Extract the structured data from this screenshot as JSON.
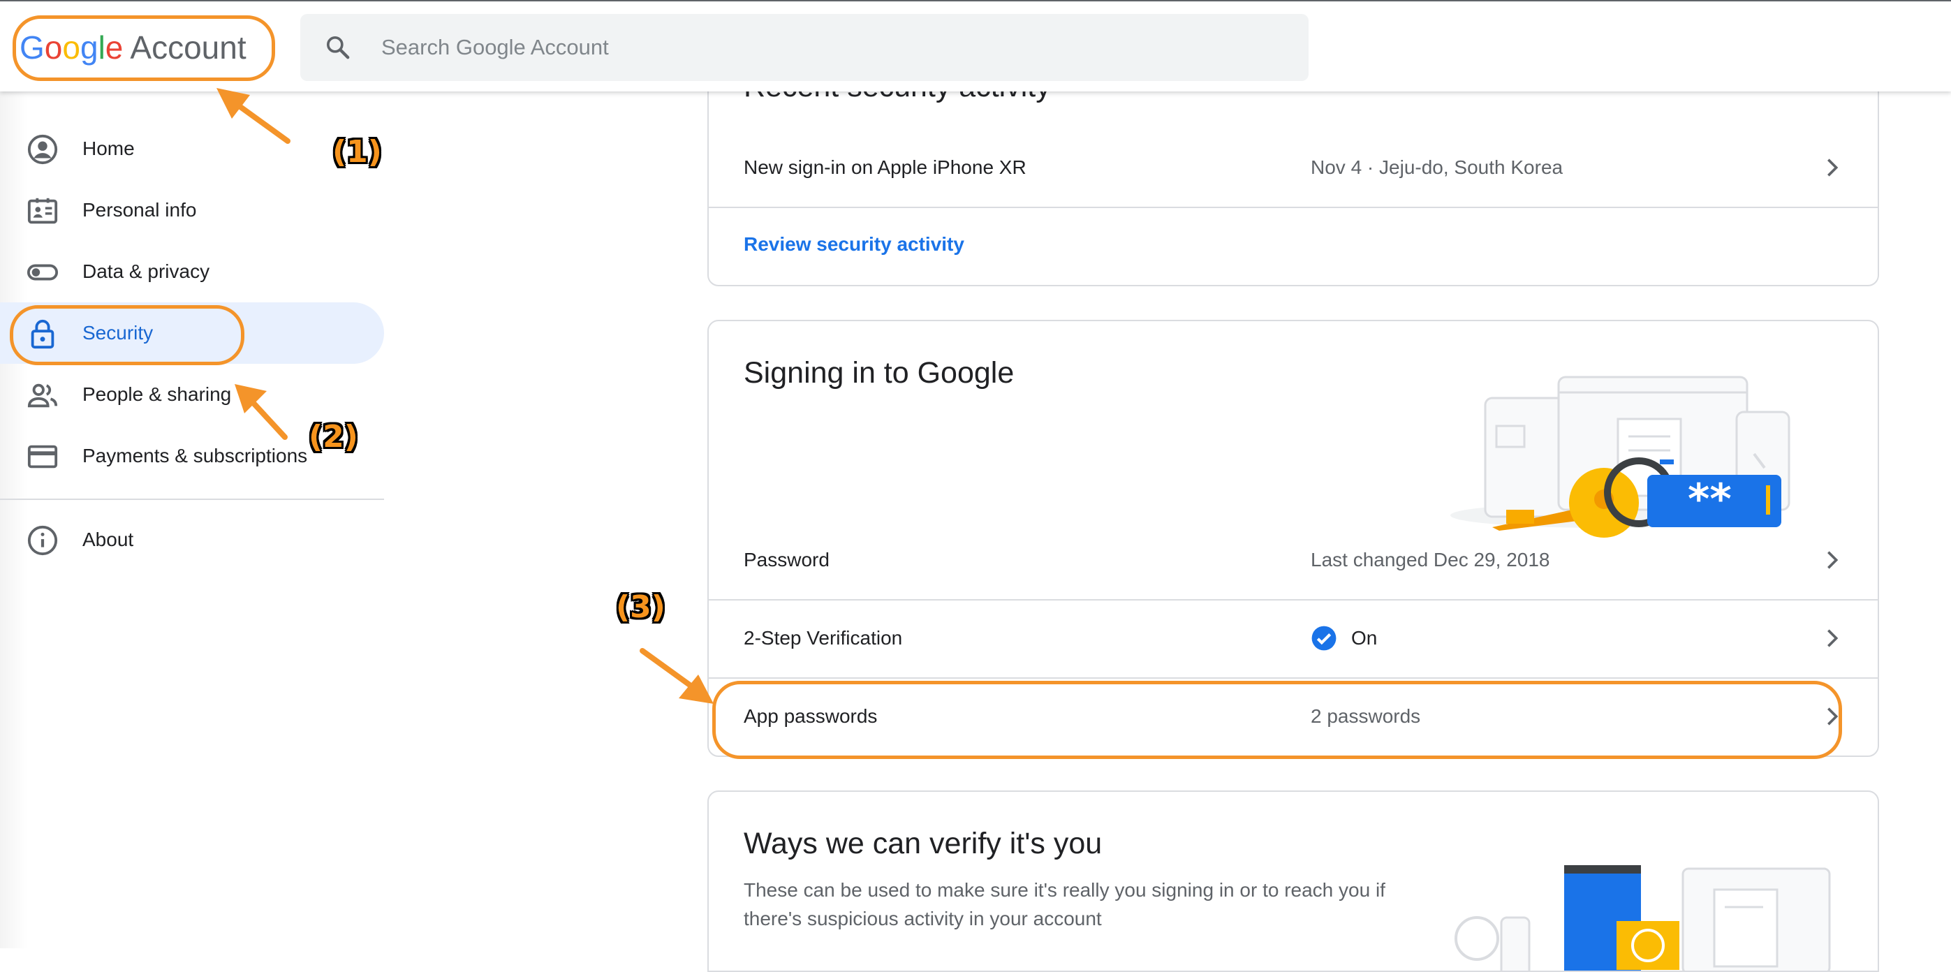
{
  "header": {
    "logo_letters": [
      "G",
      "o",
      "o",
      "g",
      "l",
      "e"
    ],
    "logo_colors": [
      "#4285f4",
      "#ea4335",
      "#fbbc05",
      "#4285f4",
      "#34a853",
      "#ea4335"
    ],
    "logo_account": "Account",
    "search_placeholder": "Search Google Account"
  },
  "sidebar": {
    "items": [
      {
        "label": "Home",
        "icon": "account-circle-icon"
      },
      {
        "label": "Personal info",
        "icon": "id-card-icon"
      },
      {
        "label": "Data & privacy",
        "icon": "toggle-icon"
      },
      {
        "label": "Security",
        "icon": "lock-icon",
        "active": true
      },
      {
        "label": "People & sharing",
        "icon": "people-icon"
      },
      {
        "label": "Payments & subscriptions",
        "icon": "credit-card-icon"
      },
      {
        "label": "About",
        "icon": "info-icon"
      }
    ]
  },
  "recent_activity": {
    "title": "Recent security activity",
    "row_label": "New sign-in on Apple iPhone XR",
    "row_value": "Nov 4 · Jeju-do, South Korea",
    "link": "Review security activity"
  },
  "signing_in": {
    "title": "Signing in to Google",
    "password_label": "Password",
    "password_value": "Last changed Dec 29, 2018",
    "two_step_label": "2-Step Verification",
    "two_step_value": "On",
    "app_passwords_label": "App passwords",
    "app_passwords_value": "2 passwords",
    "illustration_text": "**"
  },
  "verify": {
    "title": "Ways we can verify it's you",
    "description": "These can be used to make sure it's really you signing in or to reach you if there's suspicious activity in your account"
  },
  "annotations": {
    "callout_1": "(1)",
    "callout_2": "(2)",
    "callout_3": "(3)",
    "color": "#f4942a"
  }
}
